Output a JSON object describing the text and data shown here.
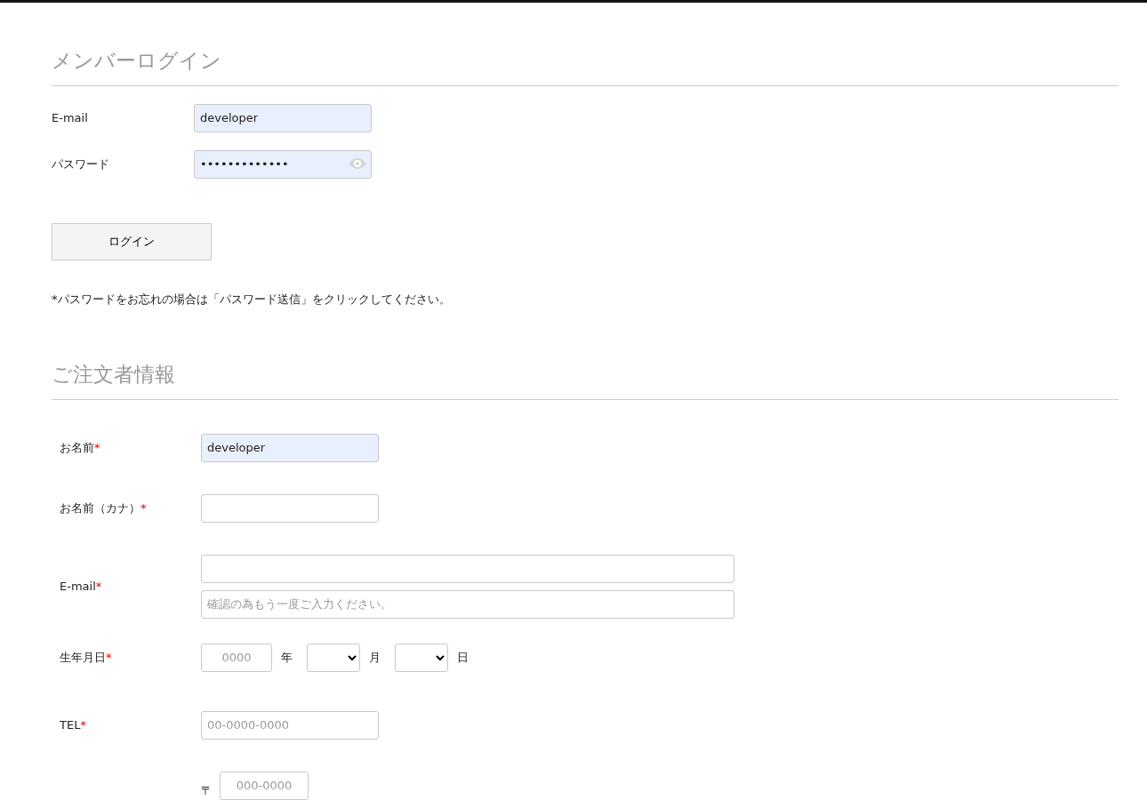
{
  "login": {
    "title": "メンバーログイン",
    "fields": [
      {
        "label": "E-mail",
        "value": "developer",
        "autofilled": true,
        "reveal_icon": false
      },
      {
        "label": "パスワード",
        "value": "•••••••••••••",
        "autofilled": true,
        "reveal_icon": true
      }
    ],
    "button": "ログイン",
    "note": "*パスワードをお忘れの場合は「パスワード送信」をクリックしてください。"
  },
  "order": {
    "title": "ご注文者情報",
    "fields": [
      {
        "kind": "text",
        "label": "お名前",
        "required_mark": "*",
        "value": "developer",
        "autofilled": true
      },
      {
        "kind": "text",
        "label": "お名前（カナ）",
        "required_mark": "*",
        "autofilled": false
      },
      {
        "kind": "email_pair",
        "label": "E-mail",
        "required_mark": "*",
        "confirm_placeholder": "確認の為もう一度ご入力ください。"
      },
      {
        "kind": "date",
        "label": "生年月日",
        "required_mark": "*",
        "year_placeholder": "0000",
        "year_unit": "年",
        "month_unit": "月",
        "day_unit": "日"
      },
      {
        "kind": "tel",
        "label": "TEL",
        "required_mark": "*",
        "placeholder": "00-0000-0000"
      },
      {
        "kind": "postal",
        "postal_mark": "〒",
        "placeholder": "000-0000"
      }
    ]
  }
}
